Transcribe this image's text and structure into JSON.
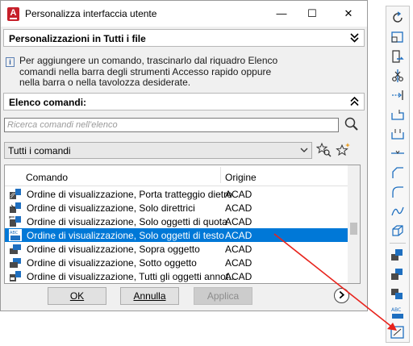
{
  "window": {
    "title": "Personalizza interfaccia utente",
    "app_badge": "A",
    "minimize": "—",
    "maximize": "☐",
    "close": "✕"
  },
  "customizations_header": "Personalizzazioni in Tutti i file",
  "info_text": "Per aggiungere un comando, trascinarlo dal riquadro Elenco comandi nella barra degli strumenti Accesso rapido oppure nella barra o nella tavolozza desiderate.",
  "command_list": {
    "header": "Elenco comandi:",
    "search_placeholder": "Ricerca comandi nell'elenco",
    "filter_value": "Tutti i comandi",
    "columns": {
      "command": "Comando",
      "source": "Origine"
    },
    "rows": [
      {
        "name": "Ordine di visualizzazione, Porta tratteggio dietro",
        "source": "ACAD",
        "selected": false,
        "icon": "draworder-hatch-back-icon"
      },
      {
        "name": "Ordine di visualizzazione, Solo direttrici",
        "source": "ACAD",
        "selected": false,
        "icon": "draworder-leaders-icon"
      },
      {
        "name": "Ordine di visualizzazione, Solo oggetti di quota",
        "source": "ACAD",
        "selected": false,
        "icon": "draworder-dimensions-icon"
      },
      {
        "name": "Ordine di visualizzazione, Solo oggetti di testo",
        "source": "ACAD",
        "selected": true,
        "icon": "draworder-text-icon"
      },
      {
        "name": "Ordine di visualizzazione, Sopra oggetto",
        "source": "ACAD",
        "selected": false,
        "icon": "draworder-above-icon"
      },
      {
        "name": "Ordine di visualizzazione, Sotto oggetto",
        "source": "ACAD",
        "selected": false,
        "icon": "draworder-under-icon"
      },
      {
        "name": "Ordine di visualizzazione, Tutti gli oggetti annot...",
        "source": "ACAD",
        "selected": false,
        "icon": "draworder-annotations-icon"
      }
    ]
  },
  "buttons": {
    "ok": "OK",
    "cancel": "Annulla",
    "apply": "Applica"
  },
  "colors": {
    "selection": "#0078d7",
    "arrow": "#e8231c",
    "icon_blue": "#1e6fc0"
  },
  "toolbar_icons": [
    "rotate-icon",
    "scale-icon",
    "stretch-icon",
    "trim-icon",
    "extend-icon",
    "break-at-point-icon",
    "break-icon",
    "join-icon",
    "chamfer-icon",
    "fillet-icon",
    "blend-curves-icon",
    "3d-operations-icon",
    "bring-to-front-icon",
    "send-to-back-icon",
    "bring-above-icon",
    "send-under-icon",
    "text-to-front-icon",
    "text-only-front-icon"
  ]
}
